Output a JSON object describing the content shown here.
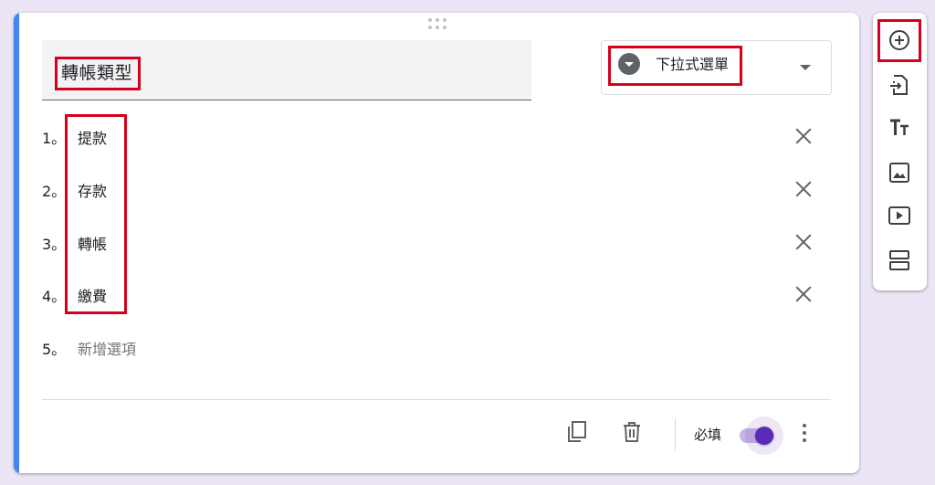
{
  "question": {
    "title": "轉帳類型",
    "type_label": "下拉式選單",
    "options": [
      {
        "num": "1。",
        "label": "提款"
      },
      {
        "num": "2。",
        "label": "存款"
      },
      {
        "num": "3。",
        "label": "轉帳"
      },
      {
        "num": "4。",
        "label": "繳費"
      }
    ],
    "add_option": {
      "num": "5。",
      "placeholder": "新增選項"
    },
    "required_label": "必填",
    "required": true
  },
  "colors": {
    "accent": "#4285f4",
    "toggle_on": "#5b2bb7",
    "highlight": "#d6001c",
    "background": "#ebe5f6"
  },
  "icons": {
    "toolbar": [
      "add-question-icon",
      "import-questions-icon",
      "add-title-icon",
      "add-image-icon",
      "add-video-icon",
      "add-section-icon"
    ],
    "footer": [
      "duplicate-icon",
      "delete-icon",
      "more-options-icon"
    ]
  }
}
